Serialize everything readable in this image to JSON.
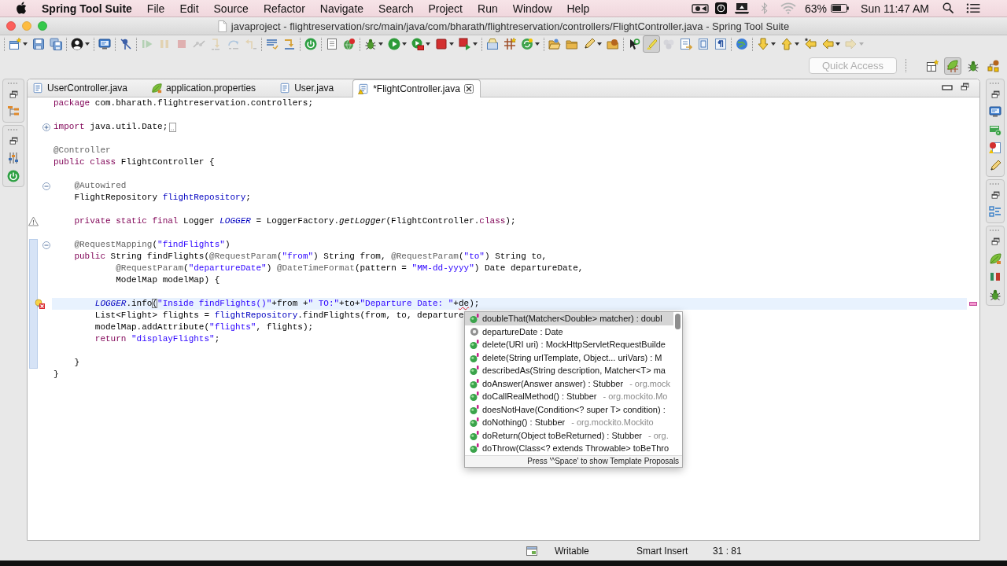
{
  "menu_bar": {
    "app_name": "Spring Tool Suite",
    "menus": [
      "File",
      "Edit",
      "Source",
      "Refactor",
      "Navigate",
      "Search",
      "Project",
      "Run",
      "Window",
      "Help"
    ],
    "battery": "63%",
    "clock": "Sun 11:47 AM"
  },
  "window": {
    "title": "javaproject - flightreservation/src/main/java/com/bharath/flightreservation/controllers/FlightController.java - Spring Tool Suite"
  },
  "toolbar": {
    "groups": [
      {
        "items": [
          {
            "kind": "new",
            "disabled": false,
            "menu": true
          },
          {
            "kind": "save",
            "disabled": false
          },
          {
            "kind": "saveall",
            "disabled": false
          }
        ]
      },
      {
        "items": [
          {
            "kind": "person",
            "disabled": false,
            "menu": true
          }
        ]
      },
      {
        "items": [
          {
            "kind": "console",
            "disabled": false
          }
        ]
      },
      {
        "items": [
          {
            "kind": "skip",
            "disabled": false
          }
        ]
      },
      {
        "items": [
          {
            "kind": "resume",
            "disabled": true
          },
          {
            "kind": "suspend",
            "disabled": true
          },
          {
            "kind": "terminate",
            "disabled": true
          },
          {
            "kind": "disconnect",
            "disabled": true
          },
          {
            "kind": "stepinto",
            "disabled": true
          },
          {
            "kind": "stepover",
            "disabled": true
          },
          {
            "kind": "stepreturn",
            "disabled": true
          }
        ]
      },
      {
        "items": [
          {
            "kind": "list",
            "disabled": false
          },
          {
            "kind": "filter",
            "disabled": false
          }
        ]
      },
      {
        "items": [
          {
            "kind": "power",
            "disabled": false
          }
        ]
      },
      {
        "items": [
          {
            "kind": "file",
            "disabled": false
          },
          {
            "kind": "refresh",
            "disabled": false
          }
        ]
      },
      {
        "items": [
          {
            "kind": "bug",
            "disabled": false,
            "menu": true
          },
          {
            "kind": "run",
            "disabled": false,
            "menu": true
          },
          {
            "kind": "coverage",
            "disabled": false,
            "menu": true
          },
          {
            "kind": "stop",
            "disabled": false,
            "menu": true
          },
          {
            "kind": "external",
            "disabled": false,
            "menu": true
          }
        ]
      },
      {
        "items": [
          {
            "kind": "newclass",
            "disabled": false
          },
          {
            "kind": "grid",
            "disabled": false
          },
          {
            "kind": "cycle",
            "disabled": false,
            "menu": true
          }
        ]
      },
      {
        "items": [
          {
            "kind": "folderopen",
            "disabled": false
          },
          {
            "kind": "folder",
            "disabled": false
          },
          {
            "kind": "pen",
            "disabled": false,
            "menu": true
          },
          {
            "kind": "spherefolder",
            "disabled": false
          }
        ]
      },
      {
        "items": [
          {
            "kind": "pointer",
            "disabled": false,
            "pressed": false
          },
          {
            "kind": "highlighter",
            "disabled": false,
            "pressed": true
          },
          {
            "kind": "balls",
            "disabled": true,
            "pressed": false
          },
          {
            "kind": "docarrow",
            "disabled": false,
            "pressed": false
          },
          {
            "kind": "page",
            "disabled": false,
            "pressed": false
          },
          {
            "kind": "pilcrow",
            "disabled": false,
            "pressed": false
          }
        ]
      },
      {
        "items": [
          {
            "kind": "globe",
            "disabled": false
          }
        ]
      },
      {
        "items": [
          {
            "kind": "down",
            "disabled": false,
            "menu": true
          },
          {
            "kind": "up",
            "disabled": false,
            "menu": true
          },
          {
            "kind": "backstar",
            "disabled": false
          },
          {
            "kind": "back",
            "disabled": false,
            "menu": true
          },
          {
            "kind": "forward",
            "disabled": true,
            "menu": true
          }
        ]
      }
    ]
  },
  "quick_access": {
    "placeholder": "Quick Access"
  },
  "perspectives": [
    {
      "kind": "spring",
      "selected": true
    },
    {
      "kind": "debug",
      "selected": false
    },
    {
      "kind": "javaee",
      "selected": false
    }
  ],
  "editor_tabs": [
    {
      "kind": "java",
      "label": "UserController.java",
      "selected": false,
      "warning": false
    },
    {
      "kind": "properties",
      "label": "application.properties",
      "selected": false,
      "warning": false
    },
    {
      "kind": "java",
      "label": "User.java",
      "selected": false,
      "warning": false
    },
    {
      "kind": "java",
      "label": "*FlightController.java",
      "selected": true,
      "warning": true
    }
  ],
  "code": {
    "lines": [
      {
        "tokens": [
          {
            "kind": "keyword",
            "text": "package"
          },
          {
            "kind": "plain",
            "text": " com.bharath.flightreservation.controllers;"
          }
        ],
        "changed": false,
        "current": false
      },
      {
        "changed": false,
        "current": false
      },
      {
        "tokens": [
          {
            "kind": "keyword",
            "text": "import"
          },
          {
            "kind": "plain",
            "text": " java.util.Date;"
          }
        ],
        "expanded": false,
        "changed": false,
        "current": false
      },
      {
        "changed": false,
        "current": false
      },
      {
        "tokens": [
          {
            "kind": "annotation",
            "text": "@Controller"
          }
        ],
        "changed": false,
        "current": false
      },
      {
        "tokens": [
          {
            "kind": "keyword",
            "text": "public"
          },
          {
            "kind": "keyword",
            "text": " class"
          },
          {
            "kind": "plain",
            "text": " FlightController {"
          }
        ],
        "changed": false,
        "current": false
      },
      {
        "changed": false,
        "current": false
      },
      {
        "tokens": [
          {
            "kind": "annotation",
            "text": "    @Autowired"
          }
        ],
        "expanded": true,
        "changed": false,
        "current": false
      },
      {
        "tokens": [
          {
            "kind": "plain",
            "text": "    FlightRepository "
          },
          {
            "kind": "field",
            "text": "flightRepository"
          },
          {
            "kind": "plain",
            "text": ";"
          }
        ],
        "changed": false,
        "current": false
      },
      {
        "changed": false,
        "current": false
      },
      {
        "tokens": [
          {
            "kind": "keyword",
            "text": "    private"
          },
          {
            "kind": "keyword",
            "text": " static"
          },
          {
            "kind": "keyword",
            "text": " final"
          },
          {
            "kind": "plain",
            "text": " Logger "
          },
          {
            "kind": "static_field",
            "text": "LOGGER"
          },
          {
            "kind": "plain",
            "text": " = LoggerFactory."
          },
          {
            "kind": "static_method",
            "text": "getLogger"
          },
          {
            "kind": "plain",
            "text": "(FlightController."
          },
          {
            "kind": "keyword",
            "text": "class"
          },
          {
            "kind": "plain",
            "text": ");"
          }
        ],
        "marker": {
          "kind": "warning"
        },
        "changed": false,
        "current": false
      },
      {
        "changed": false,
        "current": false
      },
      {
        "tokens": [
          {
            "kind": "annotation",
            "text": "    @RequestMapping"
          },
          {
            "kind": "plain",
            "text": "("
          },
          {
            "kind": "string",
            "text": "\"findFlights\""
          },
          {
            "kind": "plain",
            "text": ")"
          }
        ],
        "expanded": true,
        "changed": true,
        "current": false
      },
      {
        "tokens": [
          {
            "kind": "keyword",
            "text": "    public"
          },
          {
            "kind": "plain",
            "text": " String findFlights("
          },
          {
            "kind": "annotation",
            "text": "@RequestParam"
          },
          {
            "kind": "plain",
            "text": "("
          },
          {
            "kind": "string",
            "text": "\"from\""
          },
          {
            "kind": "plain",
            "text": ") String from, "
          },
          {
            "kind": "annotation",
            "text": "@RequestParam"
          },
          {
            "kind": "plain",
            "text": "("
          },
          {
            "kind": "string",
            "text": "\"to\""
          },
          {
            "kind": "plain",
            "text": ") String to,"
          }
        ],
        "changed": true,
        "current": false
      },
      {
        "tokens": [
          {
            "kind": "annotation",
            "text": "            @RequestParam"
          },
          {
            "kind": "plain",
            "text": "("
          },
          {
            "kind": "string",
            "text": "\"departureDate\""
          },
          {
            "kind": "plain",
            "text": ") "
          },
          {
            "kind": "annotation",
            "text": "@DateTimeFormat"
          },
          {
            "kind": "plain",
            "text": "(pattern = "
          },
          {
            "kind": "string",
            "text": "\"MM-dd-yyyy\""
          },
          {
            "kind": "plain",
            "text": ") Date departureDate,"
          }
        ],
        "changed": true,
        "current": false
      },
      {
        "tokens": [
          {
            "kind": "plain",
            "text": "            ModelMap modelMap) {"
          }
        ],
        "changed": true,
        "current": false
      },
      {
        "changed": true,
        "current": false
      },
      {
        "tokens": [
          {
            "kind": "static_field",
            "text": "        LOGGER"
          },
          {
            "kind": "plain",
            "text": ".info"
          },
          {
            "kind": "bracket",
            "text": "("
          },
          {
            "kind": "string",
            "text": "\"Inside findFlights()\""
          },
          {
            "kind": "plain",
            "text": "+from +"
          },
          {
            "kind": "string",
            "text": "\" TO:\""
          },
          {
            "kind": "plain",
            "text": "+to+"
          },
          {
            "kind": "string",
            "text": "\"Departure Date: \""
          },
          {
            "kind": "plain",
            "text": "+"
          },
          {
            "kind": "error",
            "text": "de"
          },
          {
            "kind": "plain",
            "text": ");"
          }
        ],
        "marker": {
          "kind": "error"
        },
        "changed": true,
        "current": true
      },
      {
        "tokens": [
          {
            "kind": "plain",
            "text": "        List<Flight> flights = "
          },
          {
            "kind": "field",
            "text": "flightRepository"
          },
          {
            "kind": "plain",
            "text": ".findFlights(from, to, departure"
          }
        ],
        "changed": true,
        "current": false
      },
      {
        "tokens": [
          {
            "kind": "plain",
            "text": "        modelMap.addAttribute("
          },
          {
            "kind": "string",
            "text": "\"flights\""
          },
          {
            "kind": "plain",
            "text": ", flights);"
          }
        ],
        "changed": true,
        "current": false
      },
      {
        "tokens": [
          {
            "kind": "keyword",
            "text": "        return"
          },
          {
            "kind": "string",
            "text": " \"displayFlights\""
          },
          {
            "kind": "plain",
            "text": ";"
          }
        ],
        "changed": true,
        "current": false
      },
      {
        "changed": true,
        "current": false
      },
      {
        "tokens": [
          {
            "kind": "plain",
            "text": "    }"
          }
        ],
        "changed": true,
        "current": false
      },
      {
        "tokens": [
          {
            "kind": "plain",
            "text": "}"
          }
        ],
        "changed": false,
        "current": false
      }
    ]
  },
  "proposals": {
    "items": [
      {
        "kind": "method",
        "label": "doubleThat(Matcher<Double> matcher) : doubl",
        "selected": true
      },
      {
        "kind": "local",
        "label": "departureDate : Date",
        "selected": false
      },
      {
        "kind": "method",
        "label": "delete(URI uri) : MockHttpServletRequestBuilde",
        "selected": false
      },
      {
        "kind": "method",
        "label": "delete(String urlTemplate, Object... uriVars) : M",
        "selected": false
      },
      {
        "kind": "method",
        "label": "describedAs(String description, Matcher<T> ma",
        "selected": false
      },
      {
        "kind": "method",
        "label": "doAnswer(Answer answer) : Stubber",
        "qualifier": "- org.mock",
        "selected": false
      },
      {
        "kind": "method",
        "label": "doCallRealMethod() : Stubber",
        "qualifier": "- org.mockito.Mo",
        "selected": false
      },
      {
        "kind": "method",
        "label": "doesNotHave(Condition<? super T> condition) :",
        "selected": false
      },
      {
        "kind": "method",
        "label": "doNothing() : Stubber",
        "qualifier": "- org.mockito.Mockito",
        "selected": false
      },
      {
        "kind": "method",
        "label": "doReturn(Object toBeReturned) : Stubber",
        "qualifier": "- org.",
        "selected": false
      },
      {
        "kind": "method",
        "label": "doThrow(Class<? extends Throwable> toBeThro",
        "selected": false
      }
    ],
    "hint": "Press '^Space' to show Template Proposals"
  },
  "status_bar": {
    "fields": [
      "Writable",
      "Smart Insert",
      "31 : 81"
    ]
  }
}
